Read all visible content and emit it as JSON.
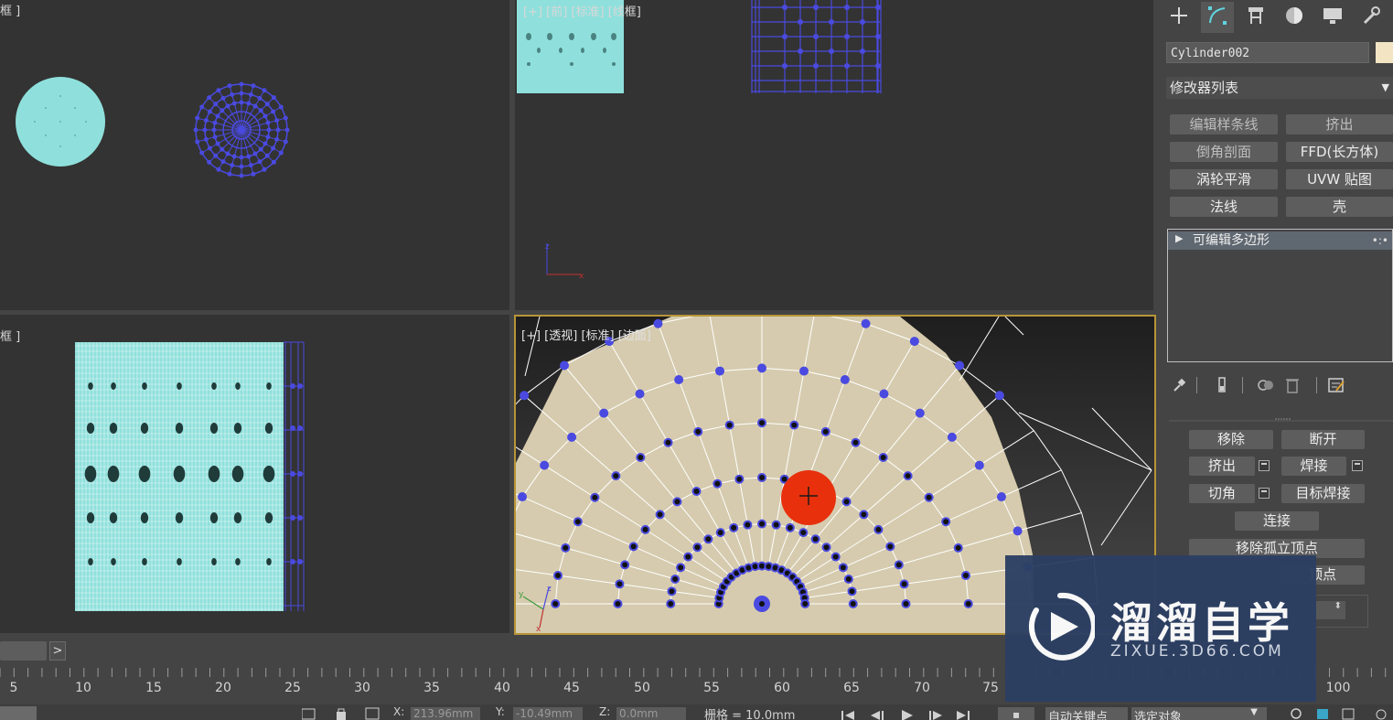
{
  "viewports": {
    "top_left": {
      "label": "框 ]"
    },
    "top_right": {
      "label": "[+] [前] [标准] [线框]"
    },
    "bottom_left": {
      "label": "框 ]"
    },
    "perspective": {
      "label": "[+] [透视] [标准] [边面]"
    }
  },
  "command_panel": {
    "tabs": [
      {
        "name": "create",
        "icon": "plus-icon"
      },
      {
        "name": "modify",
        "icon": "modify-icon"
      },
      {
        "name": "hierarchy",
        "icon": "hierarchy-icon"
      },
      {
        "name": "motion",
        "icon": "motion-icon"
      },
      {
        "name": "display",
        "icon": "display-icon"
      },
      {
        "name": "utilities",
        "icon": "wrench-icon"
      }
    ],
    "object_name": "Cylinder002",
    "object_color": "#f3e5c4",
    "modifier_list_label": "修改器列表",
    "modifier_buttons": [
      "编辑样条线",
      "挤出",
      "倒角剖面",
      "FFD(长方体)",
      "涡轮平滑",
      "UVW 贴图",
      "法线",
      "壳"
    ],
    "stack_item": "可编辑多边形",
    "edit_vertices": {
      "remove": "移除",
      "break": "断开",
      "extrude": "挤出",
      "weld": "焊接",
      "chamfer": "切角",
      "target_weld": "目标焊接",
      "connect": "连接",
      "remove_isolated": "移除孤立顶点",
      "unused_vertices": "顶点"
    }
  },
  "timeline": {
    "next_button": ">",
    "ticks": [
      "5",
      "10",
      "15",
      "20",
      "25",
      "30",
      "35",
      "40",
      "45",
      "50",
      "55",
      "60",
      "65",
      "70",
      "75",
      "100"
    ]
  },
  "status_bar": {
    "x_label": "X:",
    "x_value": "213.96mm",
    "y_label": "Y:",
    "y_value": "-10.49mm",
    "z_label": "Z:",
    "z_value": "0.0mm",
    "grid": "栅格 = 10.0mm",
    "auto_key": "自动关键点",
    "selected_object": "选定对象"
  },
  "watermark": {
    "title": "溜溜自学",
    "url": "ZIXUE.3D66.COM"
  },
  "colors": {
    "accent_vertex": "#4a4ae0",
    "mesh_cyan": "#8fe0dc",
    "mesh_beige": "#d6cbae",
    "selected_red": "#e8300c",
    "viewport_border": "#b89437"
  }
}
